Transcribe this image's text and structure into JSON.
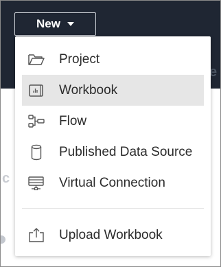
{
  "header": {
    "new_button_label": "New"
  },
  "background": {
    "right_fragment": "e",
    "left_fragment": "c"
  },
  "menu": {
    "items": [
      {
        "label": "Project",
        "icon": "folder-icon"
      },
      {
        "label": "Workbook",
        "icon": "workbook-icon",
        "selected": true
      },
      {
        "label": "Flow",
        "icon": "flow-icon"
      },
      {
        "label": "Published Data Source",
        "icon": "database-icon"
      },
      {
        "label": "Virtual Connection",
        "icon": "virtual-connection-icon"
      },
      {
        "label": "Upload Workbook",
        "icon": "upload-icon"
      }
    ]
  },
  "colors": {
    "header_bg": "#1f2633",
    "selected_bg": "#e6e6e6",
    "icon": "#555555"
  }
}
